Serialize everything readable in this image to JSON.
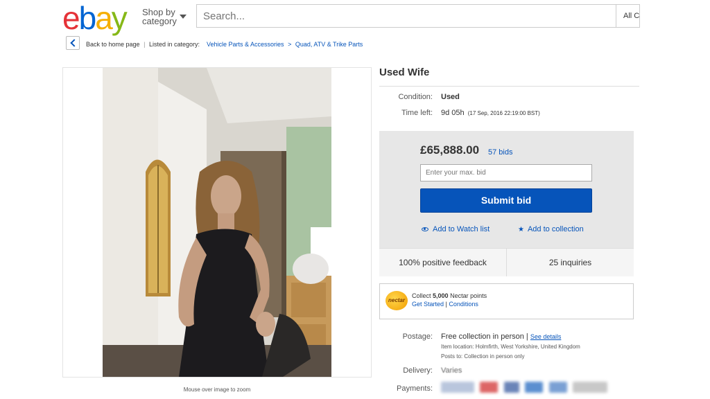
{
  "header": {
    "logo": {
      "e": "e",
      "b": "b",
      "a": "a",
      "y": "y"
    },
    "shop_by_line1": "Shop by",
    "shop_by_line2": "category",
    "search_placeholder": "Search...",
    "search_category": "All Ca"
  },
  "breadcrumb": {
    "back_label": "Back to home page",
    "separator": "|",
    "listed_in": "Listed in category:",
    "items": [
      "Vehicle Parts & Accessories",
      "Quad, ATV & Trike Parts"
    ],
    "arrow": ">"
  },
  "image": {
    "zoom_hint": "Mouse over image to zoom"
  },
  "listing": {
    "title": "Used Wife",
    "condition_label": "Condition:",
    "condition_value": "Used",
    "time_label": "Time left:",
    "time_value": "9d 05h",
    "time_detail": "(17 Sep, 2016  22:19:00 BST)"
  },
  "bid": {
    "price": "£65,888.00",
    "bids": "57 bids",
    "input_placeholder": "Enter your max. bid",
    "submit_label": "Submit bid",
    "watch_label": "Add to Watch list",
    "collection_label": "Add to collection"
  },
  "stats": {
    "feedback": "100% positive feedback",
    "inquiries": "25 inquiries"
  },
  "nectar": {
    "logo_text": "nectar",
    "collect_prefix": "Collect",
    "points": "5,000",
    "collect_suffix": "Nectar points",
    "get_started": "Get Started",
    "separator": "|",
    "conditions": "Conditions"
  },
  "shipping": {
    "postage_label": "Postage:",
    "postage_value": "Free collection in person",
    "separator": "|",
    "see_details": "See details",
    "item_location": "Item location:  Holmfirth, West Yorkshire, United Kingdom",
    "posts_to": "Posts to:  Collection in person only",
    "delivery_label": "Delivery:",
    "delivery_value": "Varies",
    "payments_label": "Payments:"
  },
  "colors": {
    "ebay_red": "#e53238",
    "ebay_blue": "#0064d2",
    "ebay_yellow": "#f5af02",
    "ebay_green": "#86b817",
    "link_blue": "#0654ba",
    "button_blue": "#0654ba"
  }
}
